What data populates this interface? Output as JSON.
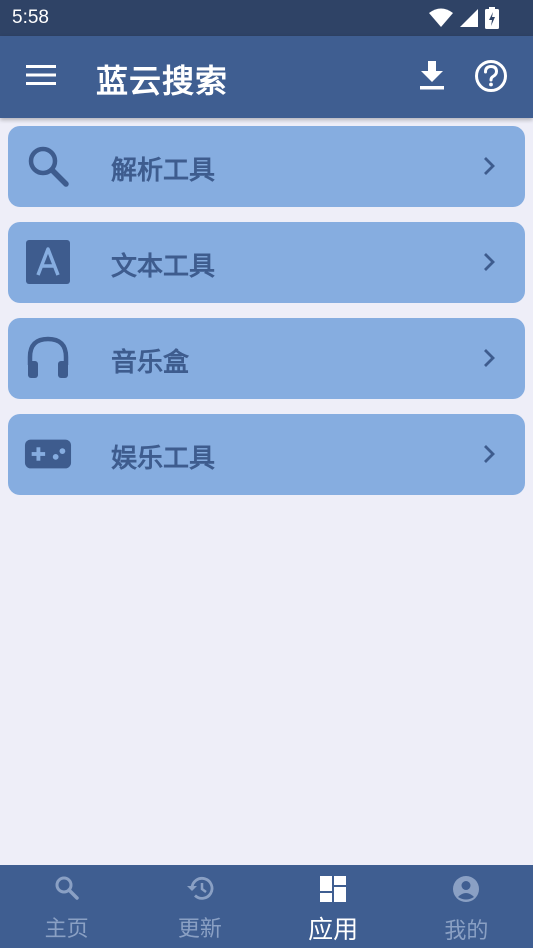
{
  "status_bar": {
    "time": "5:58",
    "icons": [
      "wifi-icon",
      "signal-icon",
      "battery-charging-icon"
    ]
  },
  "app_bar": {
    "title": "蓝云搜索",
    "menu_icon": "menu-icon",
    "actions": [
      "download-icon",
      "help-icon"
    ]
  },
  "cards": [
    {
      "label": "解析工具",
      "icon": "search-icon"
    },
    {
      "label": "文本工具",
      "icon": "text-a-icon"
    },
    {
      "label": "音乐盒",
      "icon": "headphones-icon"
    },
    {
      "label": "娱乐工具",
      "icon": "gamepad-icon"
    }
  ],
  "bottom_nav": {
    "items": [
      {
        "label": "主页",
        "icon": "search-icon",
        "active": false
      },
      {
        "label": "更新",
        "icon": "history-icon",
        "active": false
      },
      {
        "label": "应用",
        "icon": "dashboard-icon",
        "active": true
      },
      {
        "label": "我的",
        "icon": "account-icon",
        "active": false
      }
    ]
  },
  "colors": {
    "status_bar": "#2f4366",
    "app_bar": "#3f5e91",
    "background": "#eeeef8",
    "card": "#86ade0",
    "card_text": "#3e5c8e",
    "nav_inactive": "#8aa0c4",
    "nav_active": "#ffffff"
  }
}
